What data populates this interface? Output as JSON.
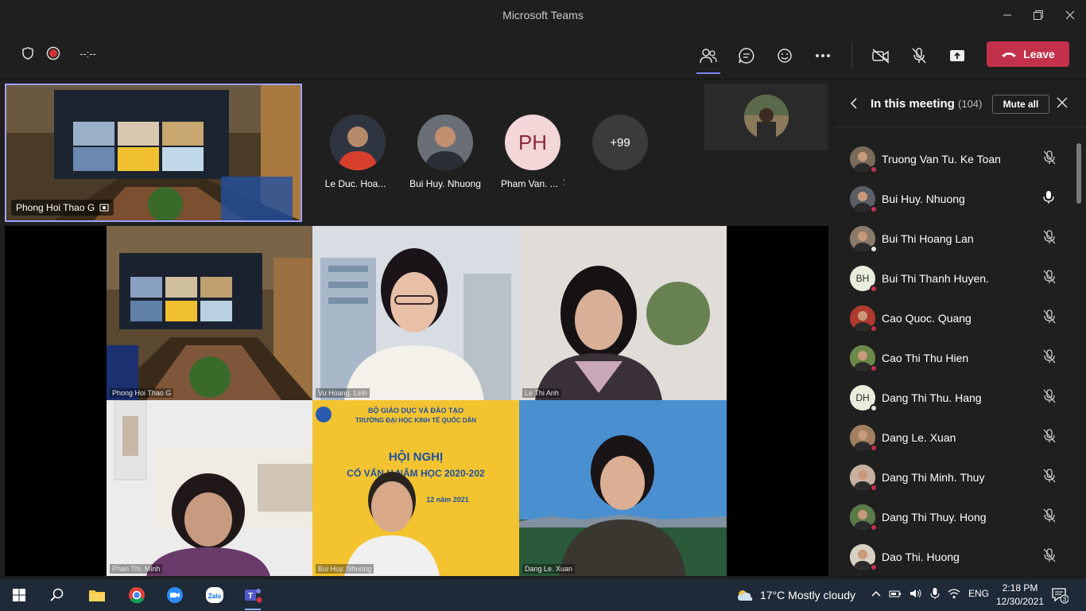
{
  "window": {
    "title": "Microsoft Teams"
  },
  "toolbar": {
    "timer": "--:--",
    "leave_label": "Leave"
  },
  "pinned": {
    "name": "Phong Hoi Thao G"
  },
  "avatars": [
    {
      "name": "Le Duc. Hoa...",
      "kind": "photo",
      "color": "#c0392b"
    },
    {
      "name": "Bui Huy. Nhuong",
      "kind": "photo",
      "color": "#5a5e66"
    },
    {
      "name": "Pham Van. ...",
      "kind": "initials",
      "initials": "PH",
      "color": "#f3d6d8"
    },
    {
      "name": "",
      "kind": "more",
      "initials": "+99",
      "color": "#3b3b3b"
    }
  ],
  "grid": [
    {
      "name": "Phong Hoi Thao G"
    },
    {
      "name": "Vu Hoang. Linh"
    },
    {
      "name": "Le Thi Anh"
    },
    {
      "name": "Phan Thi. Minh"
    },
    {
      "name": "Bui Huy. Nhuong"
    },
    {
      "name": "Dang Le. Xuan"
    }
  ],
  "banner": {
    "line1": "BỘ GIÁO DỤC VÀ ĐÀO TẠO",
    "line2": "TRƯỜNG ĐẠI HỌC KINH TẾ QUỐC DÂN",
    "line3": "HỘI NGHỊ",
    "line4": "CỐ VẤN H        NĂM HỌC 2020-202",
    "line5": "12 năm 2021"
  },
  "panel": {
    "title": "In this meeting",
    "count": "(104)",
    "mute_all": "Mute all",
    "participants": [
      {
        "name": "Truong Van Tu. Ke Toan",
        "avatar": "photo",
        "color": "#7a6a5a",
        "status": "#c4314b",
        "mic": "muted"
      },
      {
        "name": "Bui Huy. Nhuong",
        "avatar": "photo",
        "color": "#5a5e66",
        "status": "#c4314b",
        "mic": "on"
      },
      {
        "name": "Bui Thi Hoang Lan",
        "avatar": "photo",
        "color": "#8a7a6a",
        "status": "#e0e0e0",
        "mic": "muted"
      },
      {
        "name": "Bui Thi Thanh Huyen.",
        "avatar": "initials",
        "initials": "BH",
        "color": "#e8eddc",
        "status": "#c4314b",
        "mic": "muted"
      },
      {
        "name": "Cao Quoc. Quang",
        "avatar": "photo",
        "color": "#b03a2e",
        "status": "#c4314b",
        "mic": "muted"
      },
      {
        "name": "Cao Thi Thu Hien",
        "avatar": "photo",
        "color": "#6b8a4a",
        "status": "#c4314b",
        "mic": "muted"
      },
      {
        "name": "Dang Thi Thu. Hang",
        "avatar": "initials",
        "initials": "DH",
        "color": "#e8eddc",
        "status": "#e0e0e0",
        "mic": "muted"
      },
      {
        "name": "Dang Le. Xuan",
        "avatar": "photo",
        "color": "#a08060",
        "status": "#c4314b",
        "mic": "muted"
      },
      {
        "name": "Dang Thi Minh. Thuy",
        "avatar": "photo",
        "color": "#c8b0a0",
        "status": "#c4314b",
        "mic": "muted"
      },
      {
        "name": "Dang Thi Thuy. Hong",
        "avatar": "photo",
        "color": "#5a7a4a",
        "status": "#c4314b",
        "mic": "muted"
      },
      {
        "name": "Dao Thi. Huong",
        "avatar": "photo",
        "color": "#d8d0c0",
        "status": "#c4314b",
        "mic": "muted"
      }
    ]
  },
  "taskbar": {
    "weather": "17°C  Mostly cloudy",
    "lang": "ENG",
    "time": "2:18 PM",
    "date": "12/30/2021",
    "notifications": "3"
  }
}
